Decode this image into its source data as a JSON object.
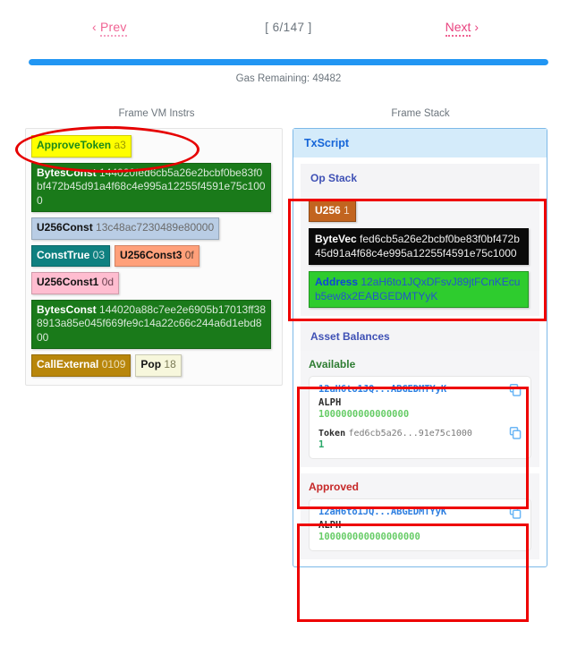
{
  "pager": {
    "prev_label": "Prev",
    "prev_arrow": "‹",
    "next_label": "Next",
    "next_arrow": "›",
    "count": "[ 6/147 ]",
    "current": 6,
    "total": 147,
    "progress_percent": 100
  },
  "gas": {
    "label": "Gas Remaining: 49482",
    "value": 49482
  },
  "columns": {
    "left_title": "Frame VM Instrs",
    "right_title": "Frame Stack"
  },
  "instructions": [
    [
      {
        "op": "ApproveToken",
        "arg": "a3",
        "style": "c-approve",
        "highlighted": true
      }
    ],
    [
      {
        "op": "BytesConst",
        "arg": "144020fed6cb5a26e2bcbf0be83f0bf472b45d91a4f68c4e995a12255f4591e75c1000",
        "style": "c-bytes"
      }
    ],
    [
      {
        "op": "U256Const",
        "arg": "13c48ac7230489e80000",
        "style": "c-u256const"
      }
    ],
    [
      {
        "op": "ConstTrue",
        "arg": "03",
        "style": "c-consttrue"
      },
      {
        "op": "U256Const3",
        "arg": "0f",
        "style": "c-u256const3"
      }
    ],
    [
      {
        "op": "U256Const1",
        "arg": "0d",
        "style": "c-u256const1"
      }
    ],
    [
      {
        "op": "BytesConst",
        "arg": "144020a88c7ee2e6905b17013ff388913a85e045f669fe9c14a22c66c244a6d1ebd800",
        "style": "c-bytes"
      }
    ],
    [
      {
        "op": "CallExternal",
        "arg": "0109",
        "style": "c-callexternal"
      },
      {
        "op": "Pop",
        "arg": "18",
        "style": "c-pop"
      }
    ]
  ],
  "frame": {
    "title": "TxScript",
    "op_stack_title": "Op Stack",
    "op_stack": [
      {
        "op": "U256",
        "arg": "1",
        "style": "s-u256"
      },
      {
        "op": "ByteVec",
        "arg": "fed6cb5a26e2bcbf0be83f0bf472b45d91a4f68c4e995a12255f4591e75c1000",
        "style": "s-bytevec"
      },
      {
        "op": "Address",
        "arg": "12aH6to1JQxDFsvJ89jtFCnKEcub5ew8x2EABGEDMTYyK",
        "style": "s-address"
      }
    ],
    "asset_balances_title": "Asset Balances",
    "available": {
      "title": "Available",
      "address": "12aH6to1JQ...ABGEDMTYyK",
      "symbol": "ALPH",
      "amount": "1000000000000000",
      "token_label": "Token",
      "token_id": "fed6cb5a26...91e75c1000",
      "token_amount": "1",
      "copy_icon": "copy-icon"
    },
    "approved": {
      "title": "Approved",
      "address": "12aH6to1JQ...ABGEDMTYyK",
      "symbol": "ALPH",
      "amount": "100000000000000000",
      "copy_icon": "copy-icon"
    }
  },
  "annotations": {
    "ellipse_target": "ApproveToken instruction",
    "box_opstack": "Op Stack contents",
    "box_available": "Available balances",
    "box_approved": "Approved balances",
    "color": "#ee0000"
  },
  "colors": {
    "accent_blue": "#2196f3",
    "link_pink": "#f06292",
    "frame_header_bg": "#d4ebfa",
    "frame_header_text": "#1565d8",
    "available_green": "#2e7d32",
    "approved_red": "#c62828"
  }
}
